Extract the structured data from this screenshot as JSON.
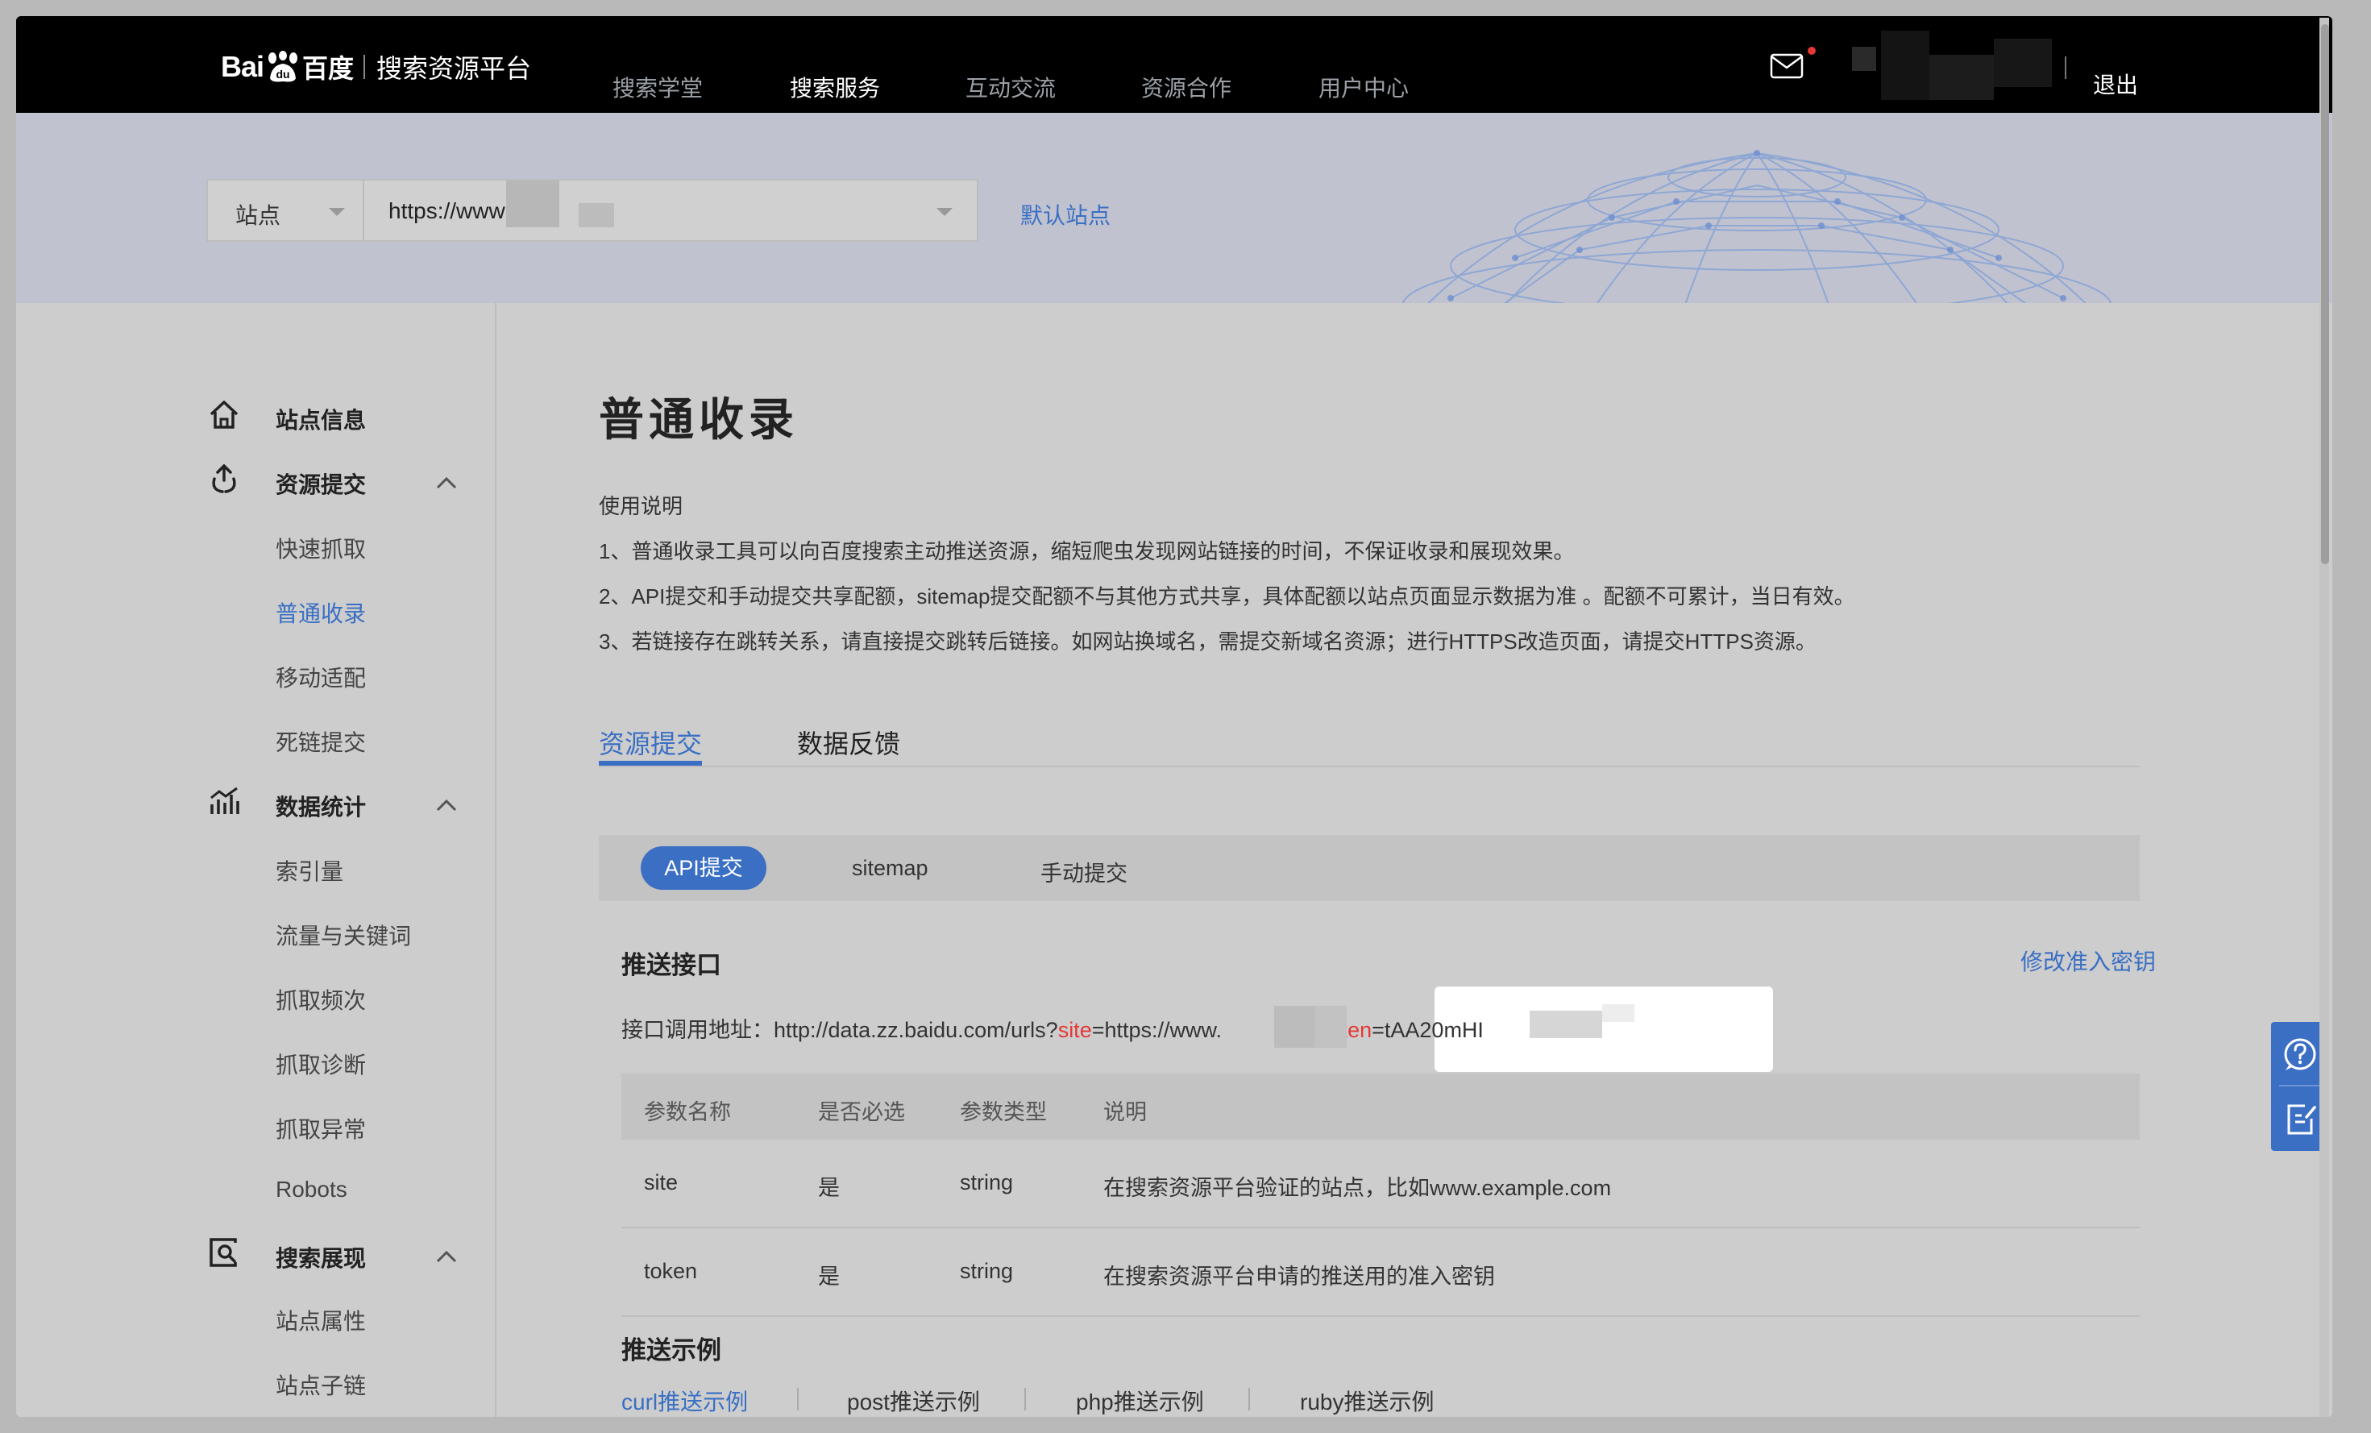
{
  "header": {
    "logo_bai": "Bai",
    "logo_cn": "百度",
    "platform": "搜索资源平台",
    "nav": [
      "搜索学堂",
      "搜索服务",
      "互动交流",
      "资源合作",
      "用户中心"
    ],
    "active_nav_index": 1,
    "logout": "退出"
  },
  "site_selector": {
    "type": "站点",
    "url": "https://www",
    "default_site": "默认站点"
  },
  "sidebar": {
    "groups": [
      {
        "label": "站点信息",
        "icon": "home-icon",
        "items": []
      },
      {
        "label": "资源提交",
        "icon": "submit-icon",
        "items": [
          "快速抓取",
          "普通收录",
          "移动适配",
          "死链提交"
        ]
      },
      {
        "label": "数据统计",
        "icon": "chart-icon",
        "items": [
          "索引量",
          "流量与关键词",
          "抓取频次",
          "抓取诊断",
          "抓取异常",
          "Robots"
        ]
      },
      {
        "label": "搜索展现",
        "icon": "search-display-icon",
        "items": [
          "站点属性",
          "站点子链"
        ]
      }
    ],
    "active_item": "普通收录"
  },
  "main": {
    "title": "普通收录",
    "usage_title": "使用说明",
    "usage": [
      "1、普通收录工具可以向百度搜索主动推送资源，缩短爬虫发现网站链接的时间，不保证收录和展现效果。",
      "2、API提交和手动提交共享配额，sitemap提交配额不与其他方式共享，具体配额以站点页面显示数据为准 。配额不可累计，当日有效。",
      "3、若链接存在跳转关系，请直接提交跳转后链接。如网站换域名，需提交新域名资源；进行HTTPS改造页面，请提交HTTPS资源。"
    ],
    "tabs": [
      "资源提交",
      "数据反馈"
    ],
    "subtabs": [
      "API提交",
      "sitemap",
      "手动提交"
    ],
    "push_title": "推送接口",
    "edit_key": "修改准入密钥",
    "api": {
      "label": "接口调用地址：",
      "base": "http://data.zz.baidu.com/urls?",
      "site_key": "site",
      "site_val": "=https://www.",
      "amp": "&",
      "token_key": "token",
      "token_val": "=tAA20mHI"
    },
    "table": {
      "headers": [
        "参数名称",
        "是否必选",
        "参数类型",
        "说明"
      ],
      "rows": [
        [
          "site",
          "是",
          "string",
          "在搜索资源平台验证的站点，比如www.example.com"
        ],
        [
          "token",
          "是",
          "string",
          "在搜索资源平台申请的推送用的准入密钥"
        ]
      ]
    },
    "examples_title": "推送示例",
    "examples": [
      "curl推送示例",
      "post推送示例",
      "php推送示例",
      "ruby推送示例"
    ]
  },
  "colors": {
    "accent": "#3a6fc4",
    "red": "#e53935",
    "nav_bg": "#000000"
  }
}
